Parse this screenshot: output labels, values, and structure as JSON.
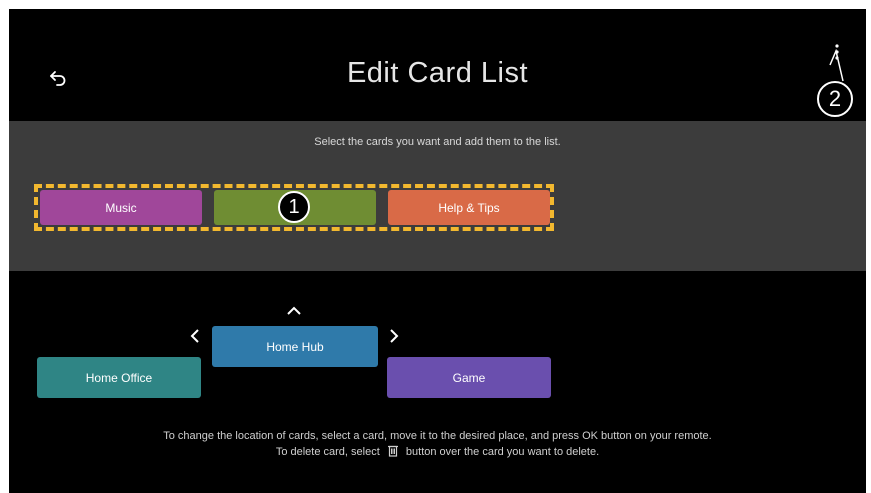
{
  "header": {
    "title": "Edit Card List",
    "back_icon": "back-arrow-icon",
    "more_icon": "vertical-dots-icon"
  },
  "callouts": {
    "one": "1",
    "two": "2"
  },
  "available": {
    "instruction": "Select the cards you want and add them to the list.",
    "cards": [
      {
        "label": "Music",
        "color": "#a0479a"
      },
      {
        "label": "",
        "color": "#6f8d33"
      },
      {
        "label": "Help & Tips",
        "color": "#d96a47"
      }
    ]
  },
  "list": {
    "cards": [
      {
        "label": "Home Office",
        "color": "#2f8585"
      },
      {
        "label": "Home Hub",
        "color": "#2f7aaa"
      },
      {
        "label": "Game",
        "color": "#6a4fae"
      }
    ],
    "up_icon": "chevron-up-icon",
    "left_icon": "chevron-left-icon",
    "right_icon": "chevron-right-icon"
  },
  "footer": {
    "line1": "To change the location of cards, select a card, move it to the desired place, and press OK button on your remote.",
    "line2_before": "To delete card, select",
    "line2_after": "button over the card you want to delete.",
    "trash_icon": "trash-icon"
  },
  "colors": {
    "highlight_dash": "#f2b82f",
    "panel": "#3c3c3c",
    "background": "#000000"
  }
}
